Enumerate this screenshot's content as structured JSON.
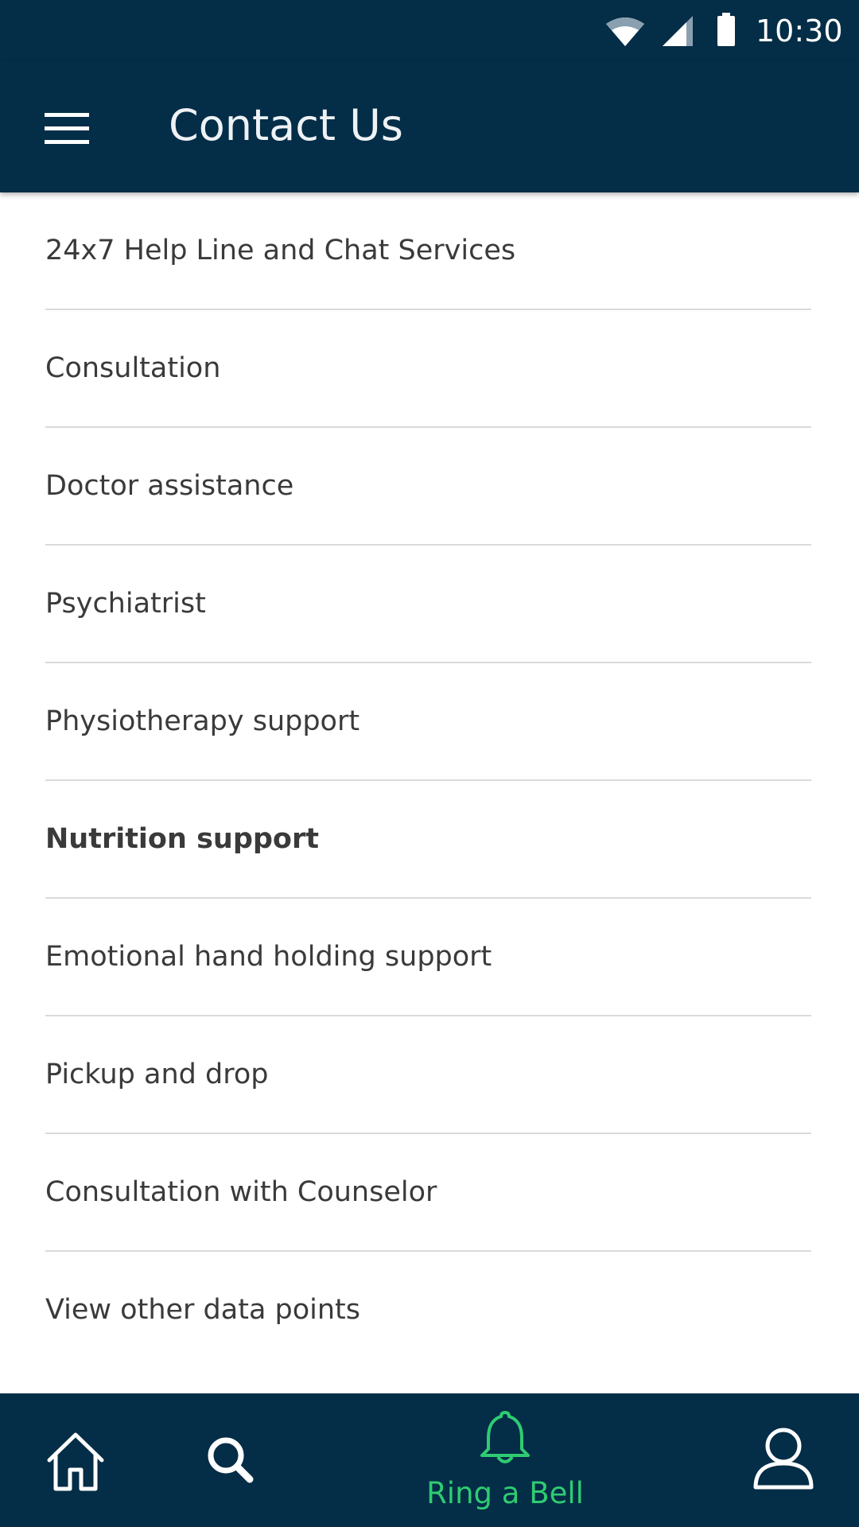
{
  "status_bar": {
    "time": "10:30",
    "icons": [
      "wifi-icon",
      "cell-signal-icon",
      "battery-icon"
    ]
  },
  "app_bar": {
    "title": "Contact Us",
    "menu_icon": "hamburger-menu-icon"
  },
  "list": {
    "items": [
      {
        "label": "24x7  Help Line and Chat Services"
      },
      {
        "label": "Consultation"
      },
      {
        "label": "Doctor assistance"
      },
      {
        "label": "Psychiatrist"
      },
      {
        "label": "Physiotherapy support"
      },
      {
        "label": "Nutrition support",
        "emphasized": true
      },
      {
        "label": "Emotional hand holding support"
      },
      {
        "label": "Pickup and drop"
      },
      {
        "label": "Consultation with Counselor"
      },
      {
        "label": "View other data points"
      }
    ]
  },
  "bottom_nav": {
    "home_icon": "home-icon",
    "search_icon": "search-icon",
    "bell_icon": "bell-icon",
    "bell_label": "Ring a Bell",
    "profile_icon": "profile-icon"
  },
  "colors": {
    "primary_dark": "#042d47",
    "accent_green": "#2ecc71",
    "text": "#3a3a3a",
    "divider": "#dadada"
  }
}
